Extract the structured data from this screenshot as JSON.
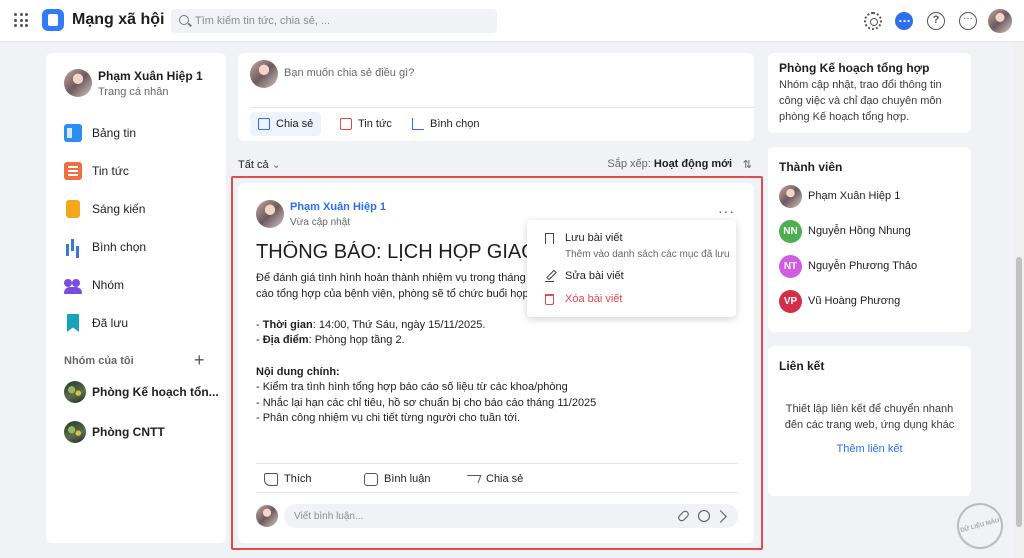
{
  "header": {
    "app_title": "Mạng xã hội",
    "search_placeholder": "Tìm kiếm tin tức, chia sẻ, ...",
    "icons": [
      "grid-icon",
      "gear-icon",
      "chat-icon",
      "help-icon",
      "more-icon",
      "avatar"
    ],
    "help_glyph": "?",
    "more_glyph": "···"
  },
  "profile": {
    "name": "Phạm Xuân Hiệp 1",
    "subtitle": "Trang cá nhân"
  },
  "sidebar": {
    "items": [
      {
        "label": "Bảng tin",
        "icon": "news-feed-icon"
      },
      {
        "label": "Tin tức",
        "icon": "article-icon"
      },
      {
        "label": "Sáng kiến",
        "icon": "bulb-icon"
      },
      {
        "label": "Bình chọn",
        "icon": "poll-icon"
      },
      {
        "label": "Nhóm",
        "icon": "group-icon"
      },
      {
        "label": "Đã lưu",
        "icon": "bookmark-icon"
      }
    ],
    "my_groups_title": "Nhóm của tôi",
    "add_glyph": "+",
    "groups": [
      {
        "label": "Phòng Kế hoạch tổn..."
      },
      {
        "label": "Phòng CNTT"
      }
    ]
  },
  "composer": {
    "placeholder": "Bạn muốn chia sẻ điều gì?",
    "buttons": [
      "Chia sẻ",
      "Tin tức",
      "Bình chọn"
    ]
  },
  "feed": {
    "filter_label": "Tất cả",
    "filter_chevron": "⌄",
    "sort_prefix": "Sắp xếp: ",
    "sort_value": "Hoạt động mới",
    "sort_glyph": "⇅"
  },
  "post": {
    "author": "Phạm Xuân Hiệp 1",
    "time": "Vừa cập nhật",
    "more_glyph": "···",
    "title": "THÔNG BÁO: LỊCH HỌP GIAO BAN",
    "intro_1": "Để đánh giá tình hình hoàn thành nhiệm vụ trong tháng và",
    "intro_2": "cáo tổng hợp của bệnh viện, phòng sẽ tổ chức buổi họp giao ban",
    "time_label": "Thời gian",
    "time_value": ": 14:00, Thứ Sáu, ngày 15/11/2025.",
    "place_label": "Địa điểm",
    "place_value": ": Phòng họp tầng 2.",
    "dash": "- ",
    "content_title": "Nội dung chính:",
    "content_items": [
      "- Kiểm tra tình hình tổng hợp báo cáo số liệu từ các khoa/phòng",
      "- Nhắc lại hạn các chỉ tiêu, hồ sơ chuẩn bị cho báo cáo tháng 11/2025",
      "- Phân công nhiệm vụ chi tiết từng người cho tuần tới."
    ],
    "actions": [
      "Thích",
      "Bình luận",
      "Chia sẻ"
    ],
    "comment_placeholder": "Viết bình luận..."
  },
  "dropdown": {
    "save_label": "Lưu bài viết",
    "save_desc": "Thêm vào danh sách các mục đã lưu",
    "edit_label": "Sửa bài viết",
    "delete_label": "Xóa bài viết"
  },
  "right": {
    "group_title": "Phòng Kế hoạch tổng hợp",
    "group_desc": "Nhóm cập nhật, trao đổi thông tin công việc và chỉ đạo chuyên môn phòng Kế hoạch tổng hợp.",
    "members_title": "Thành viên",
    "members": [
      {
        "name": "Phạm Xuân Hiệp 1",
        "initials": "",
        "color": ""
      },
      {
        "name": "Nguyễn Hồng Nhung",
        "initials": "NN",
        "color": "#4caf50"
      },
      {
        "name": "Nguyễn Phương Thảo",
        "initials": "NT",
        "color": "#d05ce3"
      },
      {
        "name": "Vũ Hoàng Phương",
        "initials": "VP",
        "color": "#d32f4a"
      }
    ],
    "links_title": "Liên kết",
    "links_desc": "Thiết lập liên kết để chuyển nhanh đến các trang web, ứng dụng khác",
    "links_action": "Thêm liên kết"
  },
  "watermark": {
    "text": "DỮ LIỆU MẪU"
  },
  "colors": {
    "accent": "#2f6fed",
    "danger": "#e5484d",
    "highlight": "#e04b4b"
  }
}
